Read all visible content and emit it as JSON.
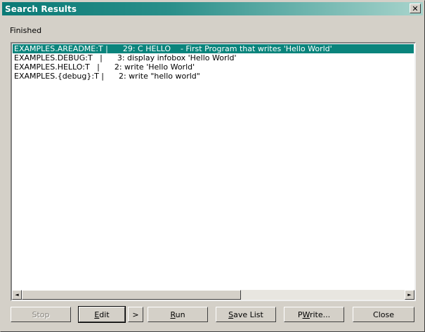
{
  "window": {
    "title": "Search Results",
    "close_glyph": "✕"
  },
  "status": "Finished",
  "results": [
    "EXAMPLES.AREADME:T |      29: C HELLO    - First Program that writes 'Hello World'",
    "EXAMPLES.DEBUG:T   |      3: display infobox 'Hello World'",
    "EXAMPLES.HELLO:T   |      2: write 'Hello World'",
    "EXAMPLES.{debug}:T |      2: write \"hello world\""
  ],
  "selected_index": 0,
  "scrollbar": {
    "left_arrow": "◄",
    "right_arrow": "►"
  },
  "buttons": {
    "stop": "Stop",
    "edit_u": "E",
    "edit_rest": "dit",
    "more": ">",
    "run_u": "R",
    "run_rest": "un",
    "save_u": "S",
    "save_rest": "ave List",
    "pwrite_pre": "P",
    "pwrite_u": "W",
    "pwrite_rest": "rite...",
    "close": "Close"
  },
  "colors": {
    "selection": "#0a847c",
    "title_start": "#0a7a76",
    "title_end": "#a8d4cc"
  }
}
